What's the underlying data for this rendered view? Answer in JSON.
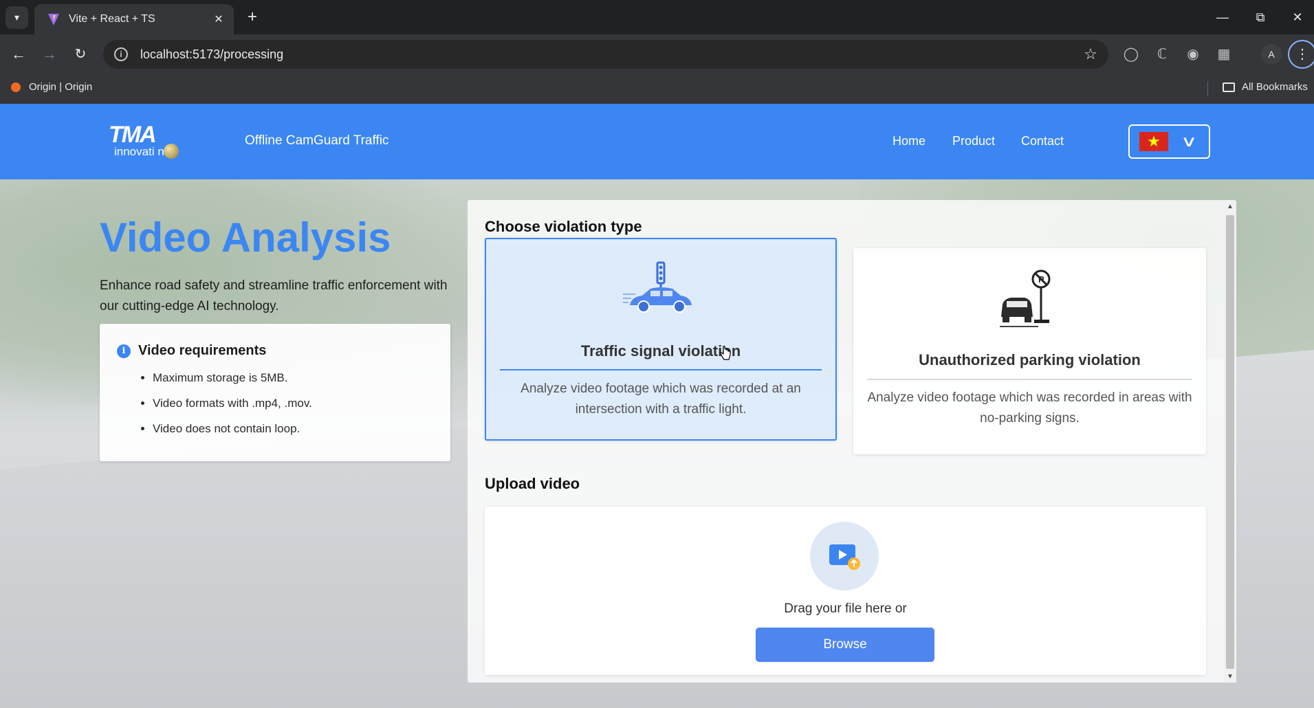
{
  "browser": {
    "tab_title": "Vite + React + TS",
    "url": "localhost:5173/processing",
    "bookmark": "Origin | Origin",
    "all_bookmarks": "All Bookmarks",
    "profile_initial": "A"
  },
  "header": {
    "logo_text": "TMA",
    "logo_sub": "innovati n",
    "site_title": "Offline CamGuard Traffic",
    "nav": [
      "Home",
      "Product",
      "Contact"
    ],
    "language_flag": "vietnam-flag-icon"
  },
  "hero": {
    "title": "Video Analysis",
    "subtitle": "Enhance road safety and streamline traffic enforcement with our cutting-edge AI technology."
  },
  "requirements": {
    "title": "Video requirements",
    "items": [
      "Maximum storage is 5MB.",
      "Video formats with .mp4, .mov.",
      "Video does not contain loop."
    ]
  },
  "violation": {
    "section_title": "Choose violation type",
    "options": [
      {
        "title": "Traffic signal violation",
        "description": "Analyze video footage which was recorded at an intersection with a traffic light.",
        "icon": "traffic-light-car-icon",
        "selected": true
      },
      {
        "title": "Unauthorized parking violation",
        "description": "Analyze video footage which was recorded in areas with no-parking signs.",
        "icon": "no-parking-car-icon",
        "selected": false
      }
    ]
  },
  "upload": {
    "section_title": "Upload video",
    "drag_text": "Drag your file here or",
    "browse_label": "Browse",
    "icon": "video-upload-icon"
  },
  "colors": {
    "brand_blue": "#3b86f2",
    "button_blue": "#4f86ef",
    "chrome_dark": "#202124"
  }
}
